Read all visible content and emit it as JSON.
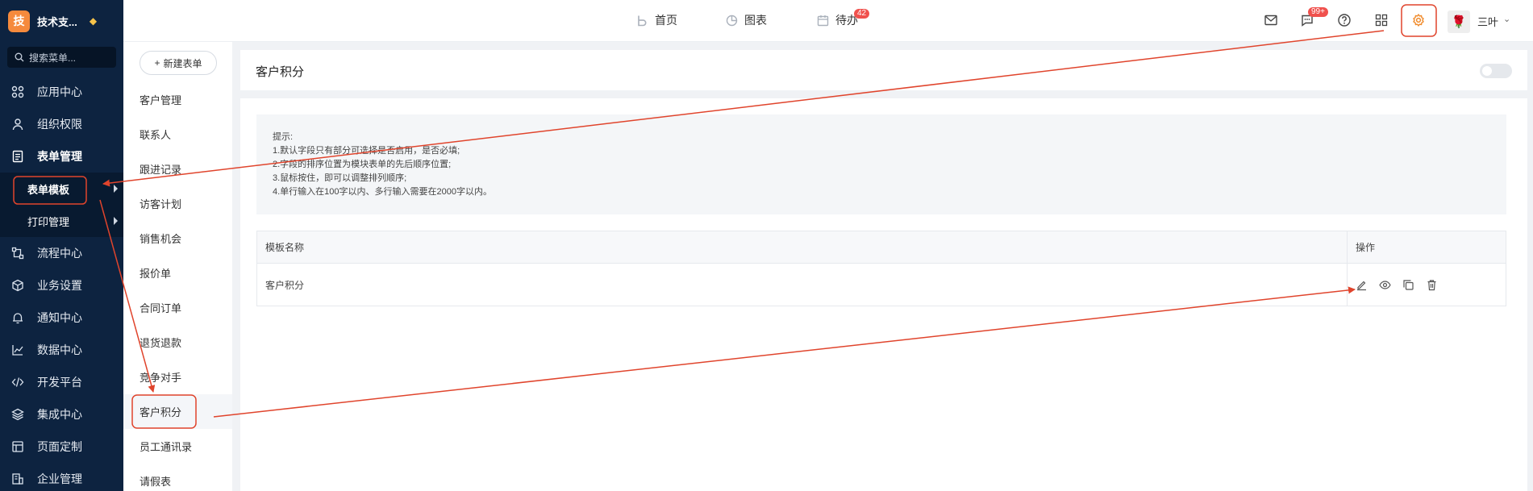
{
  "brand": {
    "logo_char": "技",
    "name": "技术支..."
  },
  "sidebar": {
    "search_placeholder": "搜索菜单...",
    "items": [
      {
        "label": "应用中心",
        "icon": "app-grid-icon"
      },
      {
        "label": "组织权限",
        "icon": "user-icon"
      },
      {
        "label": "表单管理",
        "icon": "form-icon"
      },
      {
        "label": "流程中心",
        "icon": "flow-icon"
      },
      {
        "label": "业务设置",
        "icon": "cube-icon"
      },
      {
        "label": "通知中心",
        "icon": "bell-icon"
      },
      {
        "label": "数据中心",
        "icon": "chart-icon"
      },
      {
        "label": "开发平台",
        "icon": "code-icon"
      },
      {
        "label": "集成中心",
        "icon": "layers-icon"
      },
      {
        "label": "页面定制",
        "icon": "page-icon"
      },
      {
        "label": "企业管理",
        "icon": "building-icon"
      }
    ],
    "sub_items": [
      {
        "label": "表单模板"
      },
      {
        "label": "打印管理"
      }
    ]
  },
  "topbar": {
    "nav": [
      {
        "label": "首页",
        "icon": "home-b-icon"
      },
      {
        "label": "图表",
        "icon": "pie-chart-icon"
      },
      {
        "label": "待办",
        "icon": "calendar-icon",
        "badge": "42"
      }
    ],
    "message_badge": "99+",
    "username": "三叶",
    "avatar_char": "🌹"
  },
  "form_list": {
    "new_button": "新建表单",
    "items": [
      "客户管理",
      "联系人",
      "跟进记录",
      "访客计划",
      "销售机会",
      "报价单",
      "合同订单",
      "退货退款",
      "竞争对手",
      "客户积分",
      "员工通讯录",
      "请假表"
    ],
    "selected": "客户积分"
  },
  "main": {
    "title": "客户积分",
    "tips": [
      "提示:",
      "1.默认字段只有部分可选择是否启用，是否必填;",
      "2.字段的排序位置为模块表单的先后顺序位置;",
      "3.鼠标按住，即可以调整排列顺序;",
      "4.单行输入在100字以内、多行输入需要在2000字以内。"
    ],
    "table": {
      "headers": [
        "模板名称",
        "操作"
      ],
      "rows": [
        {
          "name": "客户积分"
        }
      ]
    }
  },
  "colors": {
    "sidebar_bg": "#0d2340",
    "accent": "#f58a3d",
    "annotation": "#e0442c",
    "badge": "#f0514d"
  }
}
